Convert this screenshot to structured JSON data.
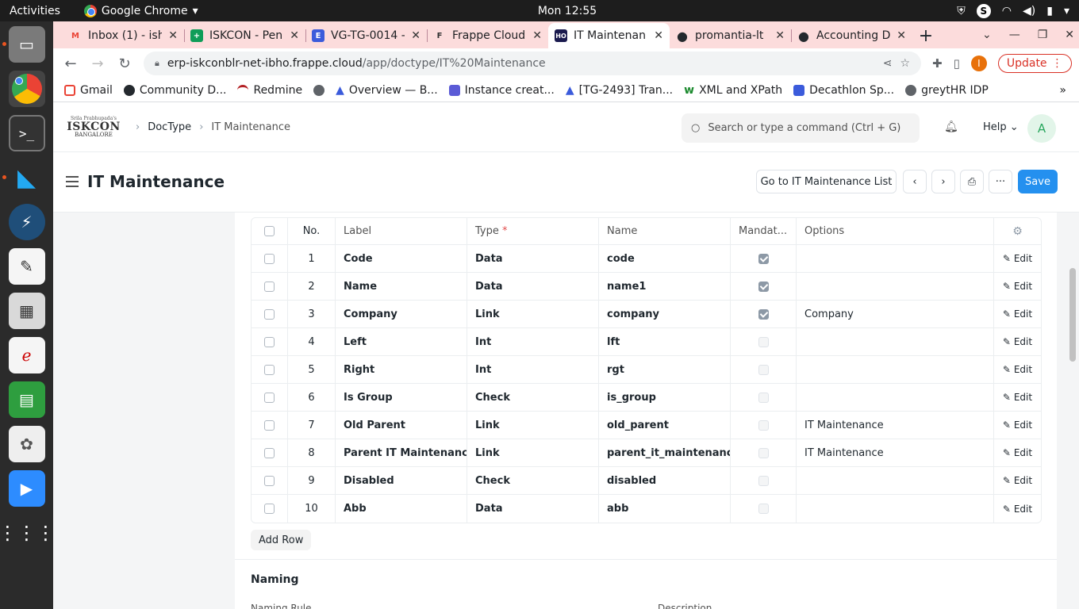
{
  "system": {
    "activities": "Activities",
    "app_name": "Google Chrome",
    "clock": "Mon 12:55"
  },
  "tabs": [
    {
      "title": "Inbox (1) - ish",
      "color": "#ea4335",
      "glyph": "M"
    },
    {
      "title": "ISKCON - Pen",
      "color": "#0f9d58",
      "glyph": "+"
    },
    {
      "title": "VG-TG-0014 -",
      "color": "#3b5bdb",
      "glyph": "E"
    },
    {
      "title": "Frappe Cloud",
      "color": "#ffffff",
      "glyph": "F"
    },
    {
      "title": "IT Maintenan",
      "color": "#1a1a4e",
      "glyph": "HO"
    },
    {
      "title": "promantia-lt",
      "color": "#24292e",
      "glyph": "●"
    },
    {
      "title": "Accounting D",
      "color": "#24292e",
      "glyph": "●"
    }
  ],
  "address": {
    "host": "erp-iskconblr-net-ibho.frappe.cloud",
    "path": "/app/doctype/IT%20Maintenance",
    "update_label": "Update",
    "profile_initial": "I"
  },
  "bookmarks": [
    {
      "label": "Gmail",
      "color": "#ea4335"
    },
    {
      "label": "Community D...",
      "color": "#24292e"
    },
    {
      "label": "Redmine",
      "color": "#b32024"
    },
    {
      "label": "",
      "color": "#5f6368"
    },
    {
      "label": "Overview — B...",
      "color": "#3b5bdb"
    },
    {
      "label": "Instance creat...",
      "color": "#5b5bd6"
    },
    {
      "label": "[TG-2493] Tran...",
      "color": "#3b5bdb"
    },
    {
      "label": "XML and XPath",
      "color": "#1b8a2e"
    },
    {
      "label": "Decathlon Sp...",
      "color": "#3b5bdb"
    },
    {
      "label": "greytHR IDP",
      "color": "#5f6368"
    }
  ],
  "navbar": {
    "logo": {
      "line1": "Srila Prabhupada's",
      "line2": "ISKCON",
      "line3": "BANGALORE"
    },
    "breadcrumbs": [
      "DocType",
      "IT Maintenance"
    ],
    "search_placeholder": "Search or type a command (Ctrl + G)",
    "help_label": "Help",
    "avatar_initial": "A"
  },
  "page": {
    "title": "IT Maintenance",
    "go_to_list": "Go to IT Maintenance List",
    "save": "Save"
  },
  "fields_table": {
    "columns": [
      "No.",
      "Label",
      "Type",
      "Name",
      "Mandat...",
      "Options"
    ],
    "type_required_marker": "*",
    "edit_label": "Edit",
    "rows": [
      {
        "no": "1",
        "label": "Code",
        "type": "Data",
        "name": "code",
        "mandatory": true,
        "options": ""
      },
      {
        "no": "2",
        "label": "Name",
        "type": "Data",
        "name": "name1",
        "mandatory": true,
        "options": ""
      },
      {
        "no": "3",
        "label": "Company",
        "type": "Link",
        "name": "company",
        "mandatory": true,
        "options": "Company"
      },
      {
        "no": "4",
        "label": "Left",
        "type": "Int",
        "name": "lft",
        "mandatory": false,
        "options": ""
      },
      {
        "no": "5",
        "label": "Right",
        "type": "Int",
        "name": "rgt",
        "mandatory": false,
        "options": ""
      },
      {
        "no": "6",
        "label": "Is Group",
        "type": "Check",
        "name": "is_group",
        "mandatory": false,
        "options": ""
      },
      {
        "no": "7",
        "label": "Old Parent",
        "type": "Link",
        "name": "old_parent",
        "mandatory": false,
        "options": "IT Maintenance"
      },
      {
        "no": "8",
        "label": "Parent IT Maintenance",
        "type": "Link",
        "name": "parent_it_maintenance",
        "mandatory": false,
        "options": "IT Maintenance"
      },
      {
        "no": "9",
        "label": "Disabled",
        "type": "Check",
        "name": "disabled",
        "mandatory": false,
        "options": ""
      },
      {
        "no": "10",
        "label": "Abb",
        "type": "Data",
        "name": "abb",
        "mandatory": false,
        "options": ""
      }
    ],
    "add_row": "Add Row"
  },
  "naming": {
    "heading": "Naming",
    "naming_rule": "Naming Rule",
    "description": "Description"
  }
}
